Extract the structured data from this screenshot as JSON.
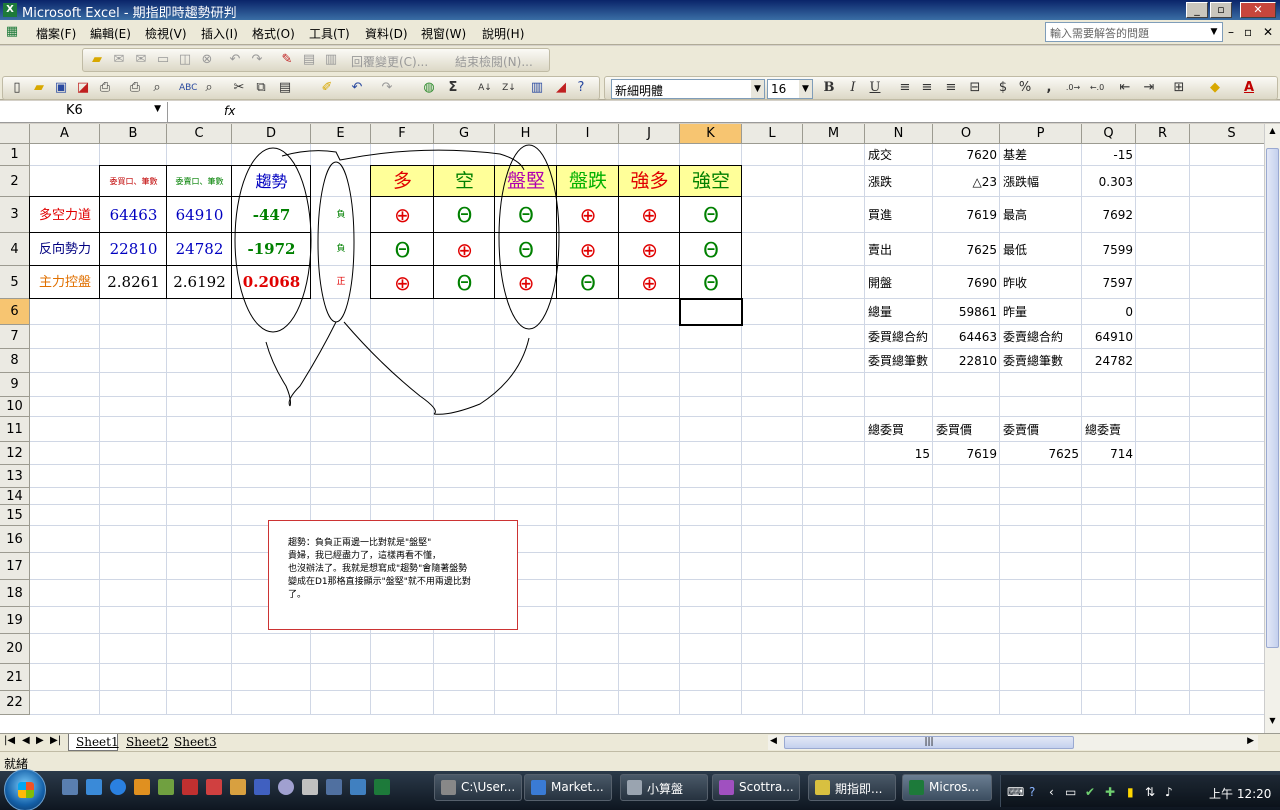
{
  "window": {
    "title": "Microsoft Excel - 期指即時趨勢研判",
    "app_icon": "X",
    "min": "_",
    "restore": "▫",
    "close": "✕"
  },
  "menu": [
    "檔案(F)",
    "編輯(E)",
    "檢視(V)",
    "插入(I)",
    "格式(O)",
    "工具(T)",
    "資料(D)",
    "視窗(W)",
    "說明(H)"
  ],
  "help_placeholder": "輸入需要解答的問題",
  "review_bar": {
    "reply": "回覆變更(C)...",
    "end": "結束檢閱(N)..."
  },
  "format": {
    "font": "新細明體",
    "size": "16",
    "bold": "B",
    "italic": "I",
    "underline": "U",
    "currency": "$",
    "percent": "%",
    "comma": ","
  },
  "name_box": "K6",
  "fx": "fx",
  "columns": [
    "A",
    "B",
    "C",
    "D",
    "E",
    "F",
    "G",
    "H",
    "I",
    "J",
    "K",
    "L",
    "M",
    "N",
    "O",
    "P",
    "Q",
    "R",
    "S"
  ],
  "rows": [
    "1",
    "2",
    "3",
    "4",
    "5",
    "6",
    "7",
    "8",
    "9",
    "10",
    "11",
    "12",
    "13",
    "14",
    "15",
    "16",
    "17",
    "18",
    "19",
    "20",
    "21",
    "22"
  ],
  "selected_cell": "K6",
  "cells": [
    {
      "ref": "B2",
      "v": "委買口、筆數",
      "color": "#c00000",
      "size": 8,
      "al": "c"
    },
    {
      "ref": "C2",
      "v": "委賣口、筆數",
      "color": "#008000",
      "size": 8,
      "al": "c"
    },
    {
      "ref": "D2",
      "v": "趨勢",
      "color": "#0000c0",
      "size": 16,
      "al": "c"
    },
    {
      "ref": "A3",
      "v": "多空力道",
      "color": "#e00000",
      "size": 13,
      "al": "c"
    },
    {
      "ref": "B3",
      "v": "64463",
      "color": "#0000c0",
      "size": 15,
      "al": "c",
      "serif": true
    },
    {
      "ref": "C3",
      "v": "64910",
      "color": "#0000c0",
      "size": 15,
      "al": "c",
      "serif": true
    },
    {
      "ref": "D3",
      "v": "-447",
      "color": "#008000",
      "size": 15,
      "al": "c",
      "serif": true,
      "bold": true
    },
    {
      "ref": "E3",
      "v": "負",
      "color": "#008000",
      "size": 9,
      "al": "c"
    },
    {
      "ref": "A4",
      "v": "反向勢力",
      "color": "#000080",
      "size": 13,
      "al": "c"
    },
    {
      "ref": "B4",
      "v": "22810",
      "color": "#0000c0",
      "size": 15,
      "al": "c",
      "serif": true
    },
    {
      "ref": "C4",
      "v": "24782",
      "color": "#0000c0",
      "size": 15,
      "al": "c",
      "serif": true
    },
    {
      "ref": "D4",
      "v": "-1972",
      "color": "#008000",
      "size": 15,
      "al": "c",
      "serif": true,
      "bold": true
    },
    {
      "ref": "E4",
      "v": "負",
      "color": "#008000",
      "size": 9,
      "al": "c"
    },
    {
      "ref": "A5",
      "v": "主力控盤",
      "color": "#e07000",
      "size": 13,
      "al": "c"
    },
    {
      "ref": "B5",
      "v": "2.8261",
      "color": "#000000",
      "size": 15,
      "al": "c",
      "serif": true
    },
    {
      "ref": "C5",
      "v": "2.6192",
      "color": "#000000",
      "size": 15,
      "al": "c",
      "serif": true
    },
    {
      "ref": "D5",
      "v": "0.2068",
      "color": "#e00000",
      "size": 15,
      "al": "c",
      "serif": true,
      "bold": true
    },
    {
      "ref": "E5",
      "v": "正",
      "color": "#e00000",
      "size": 9,
      "al": "c"
    },
    {
      "ref": "N1",
      "v": "成交",
      "size": 12,
      "al": "l"
    },
    {
      "ref": "O1",
      "v": "7620",
      "size": 12,
      "al": "r"
    },
    {
      "ref": "P1",
      "v": "基差",
      "size": 12,
      "al": "l"
    },
    {
      "ref": "Q1",
      "v": "-15",
      "size": 12,
      "al": "r"
    },
    {
      "ref": "N2",
      "v": "漲跌",
      "size": 12,
      "al": "l"
    },
    {
      "ref": "O2",
      "v": "△23",
      "size": 12,
      "al": "r"
    },
    {
      "ref": "P2",
      "v": "漲跌幅",
      "size": 12,
      "al": "l"
    },
    {
      "ref": "Q2",
      "v": "0.303",
      "size": 12,
      "al": "r"
    },
    {
      "ref": "N3",
      "v": "買進",
      "size": 12,
      "al": "l"
    },
    {
      "ref": "O3",
      "v": "7619",
      "size": 12,
      "al": "r"
    },
    {
      "ref": "P3",
      "v": "最高",
      "size": 12,
      "al": "l"
    },
    {
      "ref": "Q3",
      "v": "7692",
      "size": 12,
      "al": "r"
    },
    {
      "ref": "N4",
      "v": "賣出",
      "size": 12,
      "al": "l"
    },
    {
      "ref": "O4",
      "v": "7625",
      "size": 12,
      "al": "r"
    },
    {
      "ref": "P4",
      "v": "最低",
      "size": 12,
      "al": "l"
    },
    {
      "ref": "Q4",
      "v": "7599",
      "size": 12,
      "al": "r"
    },
    {
      "ref": "N5",
      "v": "開盤",
      "size": 12,
      "al": "l"
    },
    {
      "ref": "O5",
      "v": "7690",
      "size": 12,
      "al": "r"
    },
    {
      "ref": "P5",
      "v": "昨收",
      "size": 12,
      "al": "l"
    },
    {
      "ref": "Q5",
      "v": "7597",
      "size": 12,
      "al": "r"
    },
    {
      "ref": "N6",
      "v": "總量",
      "size": 12,
      "al": "l"
    },
    {
      "ref": "O6",
      "v": "59861",
      "size": 12,
      "al": "r"
    },
    {
      "ref": "P6",
      "v": "昨量",
      "size": 12,
      "al": "l"
    },
    {
      "ref": "Q6",
      "v": "0",
      "size": 12,
      "al": "r"
    },
    {
      "ref": "N7",
      "v": "委買總合約",
      "size": 12,
      "al": "l"
    },
    {
      "ref": "O7",
      "v": "64463",
      "size": 12,
      "al": "r"
    },
    {
      "ref": "P7",
      "v": "委賣總合約",
      "size": 12,
      "al": "l"
    },
    {
      "ref": "Q7",
      "v": "64910",
      "size": 12,
      "al": "r"
    },
    {
      "ref": "N8",
      "v": "委買總筆數",
      "size": 12,
      "al": "l"
    },
    {
      "ref": "O8",
      "v": "22810",
      "size": 12,
      "al": "r"
    },
    {
      "ref": "P8",
      "v": "委賣總筆數",
      "size": 12,
      "al": "l"
    },
    {
      "ref": "Q8",
      "v": "24782",
      "size": 12,
      "al": "r"
    },
    {
      "ref": "N11",
      "v": "總委買",
      "size": 12,
      "al": "l"
    },
    {
      "ref": "O11",
      "v": "委買價",
      "size": 12,
      "al": "l"
    },
    {
      "ref": "P11",
      "v": "委賣價",
      "size": 12,
      "al": "l"
    },
    {
      "ref": "Q11",
      "v": "總委賣",
      "size": 12,
      "al": "l"
    },
    {
      "ref": "N12",
      "v": "15",
      "size": 12,
      "al": "r"
    },
    {
      "ref": "O12",
      "v": "7619",
      "size": 12,
      "al": "r"
    },
    {
      "ref": "P12",
      "v": "7625",
      "size": 12,
      "al": "r"
    },
    {
      "ref": "Q12",
      "v": "714",
      "size": 12,
      "al": "r"
    }
  ],
  "trend_headers": [
    {
      "ref": "F2",
      "v": "多",
      "color": "#e00000"
    },
    {
      "ref": "G2",
      "v": "空",
      "color": "#008000"
    },
    {
      "ref": "H2",
      "v": "盤堅",
      "color": "#b000b0"
    },
    {
      "ref": "I2",
      "v": "盤跌",
      "color": "#00b000"
    },
    {
      "ref": "J2",
      "v": "強多",
      "color": "#e00000"
    },
    {
      "ref": "K2",
      "v": "強空",
      "color": "#008000"
    }
  ],
  "trend_header_bg": "#ffff99",
  "signals": {
    "up_symbol": "⊕",
    "down_symbol": "Θ",
    "up_color": "#e00000",
    "down_color": "#008000",
    "rows": [
      {
        "row": 3,
        "values": [
          "up",
          "down",
          "down",
          "up",
          "up",
          "down"
        ]
      },
      {
        "row": 4,
        "values": [
          "down",
          "up",
          "down",
          "up",
          "up",
          "down"
        ]
      },
      {
        "row": 5,
        "values": [
          "up",
          "down",
          "up",
          "down",
          "up",
          "down"
        ]
      }
    ]
  },
  "comment": "趨勢：負負正兩邊一比對就是\"盤堅\"\n貴婦，我已經盡力了，這樣再看不懂，\n也沒辦法了。我就是想寫成\"趨勢\"會隨著盤勢\n變成在D1那格直接顯示\"盤堅\"就不用兩邊比對\n了。",
  "sheets": [
    "Sheet1",
    "Sheet2",
    "Sheet3"
  ],
  "active_sheet": "Sheet1",
  "status": "就緒",
  "taskbar": {
    "items": [
      {
        "label": "C:\\User...",
        "icon_color": "#888888"
      },
      {
        "label": "Market...",
        "icon_color": "#3a7bd5"
      },
      {
        "label": "小算盤",
        "icon_color": "#9aa4b0"
      },
      {
        "label": "Scottra...",
        "icon_color": "#a050c0"
      },
      {
        "label": "期指即...",
        "icon_color": "#d8c040"
      },
      {
        "label": "Micros...",
        "icon_color": "#1d7a3a",
        "active": true
      }
    ],
    "clock": "上午 12:20"
  }
}
